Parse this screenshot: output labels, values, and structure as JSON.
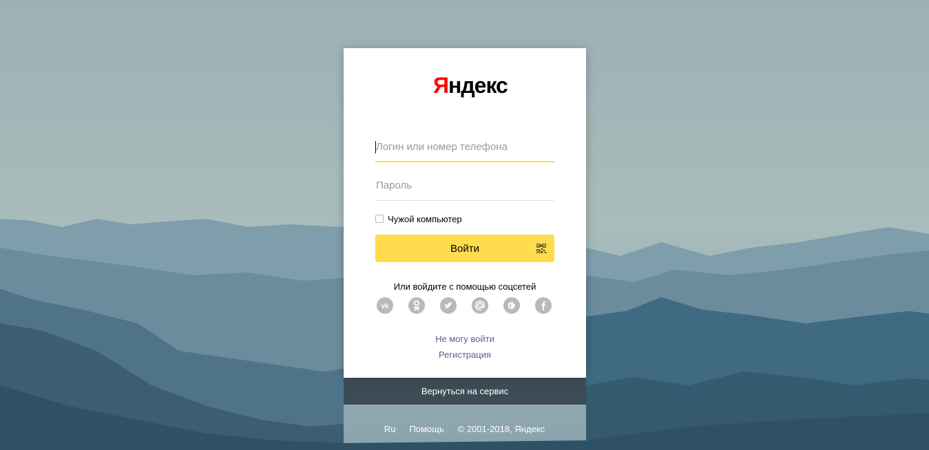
{
  "logo": {
    "first": "Я",
    "rest": "ндекс"
  },
  "login": {
    "placeholder": "Логин или номер телефона",
    "value": ""
  },
  "password": {
    "placeholder": "Пароль",
    "value": ""
  },
  "remember": {
    "label": "Чужой компьютер",
    "checked": false
  },
  "submit": {
    "label": "Войти",
    "qr_icon": "qr-code-icon"
  },
  "social": {
    "title": "Или войдите с помощью соцсетей",
    "items": [
      "vk-icon",
      "odnoklassniki-icon",
      "twitter-icon",
      "mail-ru-icon",
      "google-icon",
      "facebook-icon"
    ]
  },
  "links": {
    "cant_login": "Не могу войти",
    "register": "Регистрация"
  },
  "back": {
    "label": "Вернуться на сервис"
  },
  "footer": {
    "lang": "Ru",
    "help": "Помощь",
    "copyright": "© 2001-2018, Яндекс"
  },
  "colors": {
    "accent": "#ffdb4d",
    "brand_red": "#ff0000",
    "link": "#59628f"
  }
}
